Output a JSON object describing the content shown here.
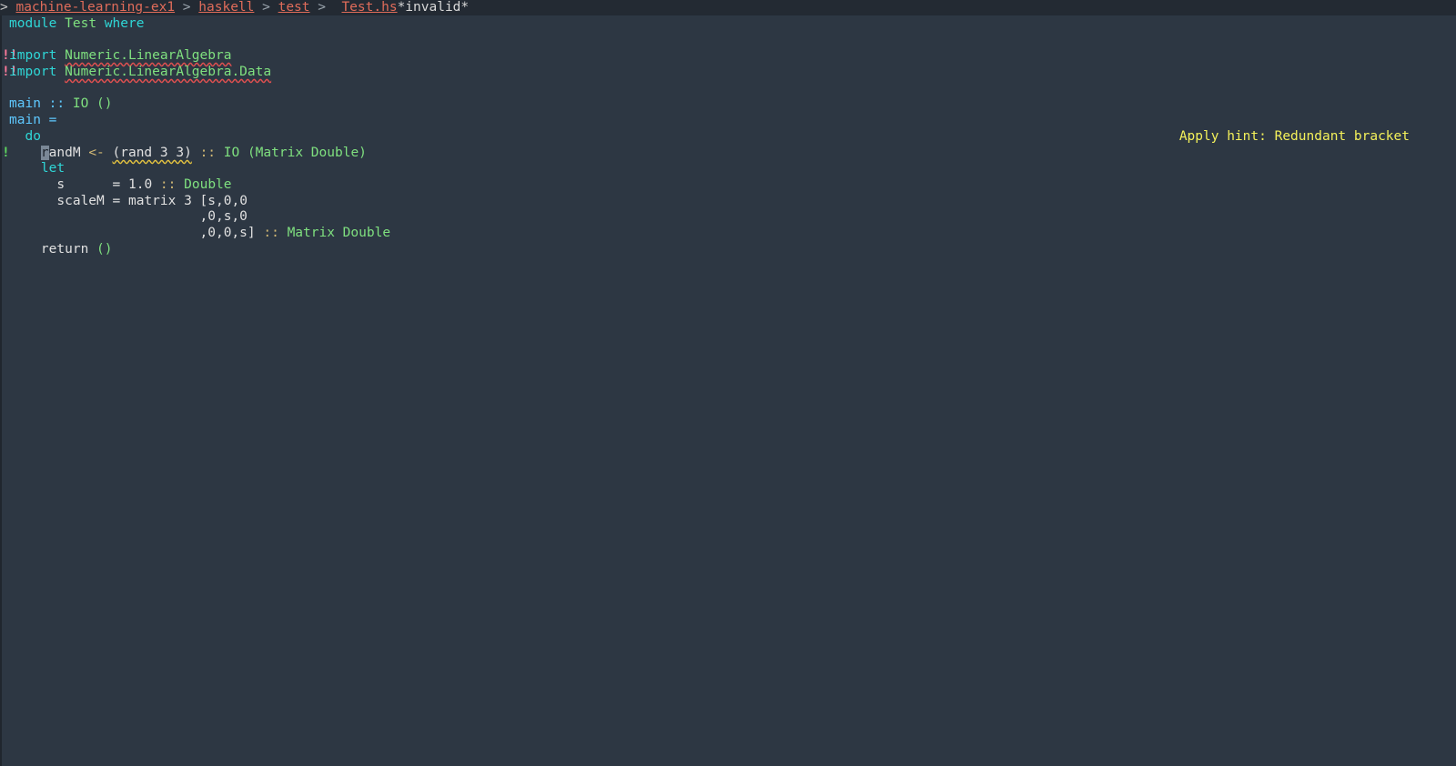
{
  "breadcrumb": {
    "prefix": "> ",
    "items": [
      "machine-learning-ex1",
      "haskell",
      "test"
    ],
    "separator": " > ",
    "file": "Test.hs",
    "status": "*invalid*"
  },
  "code": {
    "line1": {
      "kw1": "module",
      "name": "Test",
      "kw2": "where"
    },
    "line3": {
      "kw": "import",
      "module": "Numeric.LinearAlgebra"
    },
    "line4": {
      "kw": "import",
      "module": "Numeric.LinearAlgebra.Data"
    },
    "line6": {
      "name": "main",
      "op": "::",
      "type": "IO ()"
    },
    "line7": {
      "name": "main",
      "op": "="
    },
    "line8": {
      "kw": "do"
    },
    "line9": {
      "cursor_char": "r",
      "rest": "andM",
      "arrow": "<-",
      "expr": "(rand 3 3)",
      "op": "::",
      "type": "IO (Matrix Double)"
    },
    "line10": {
      "kw": "let"
    },
    "line11": {
      "name": "s",
      "eq": "=",
      "value": "1.0",
      "op": "::",
      "type": "Double"
    },
    "line12": {
      "name": "scaleM",
      "eq": "=",
      "expr": "matrix 3 [s,0,0"
    },
    "line13": {
      "expr": ",0,s,0"
    },
    "line14": {
      "expr": ",0,0,s]",
      "op": "::",
      "type": "Matrix Double"
    },
    "line15": {
      "kw": "return",
      "unit": "()"
    }
  },
  "gutter": {
    "error_marker": "!!",
    "warning_marker": "!"
  },
  "hint": "Apply hint: Redundant bracket",
  "colors": {
    "background": "#2d3743",
    "keyword": "#2fd6d6",
    "type": "#7fe07f",
    "breadcrumb": "#e06c5a",
    "hint": "#f4f15a"
  }
}
